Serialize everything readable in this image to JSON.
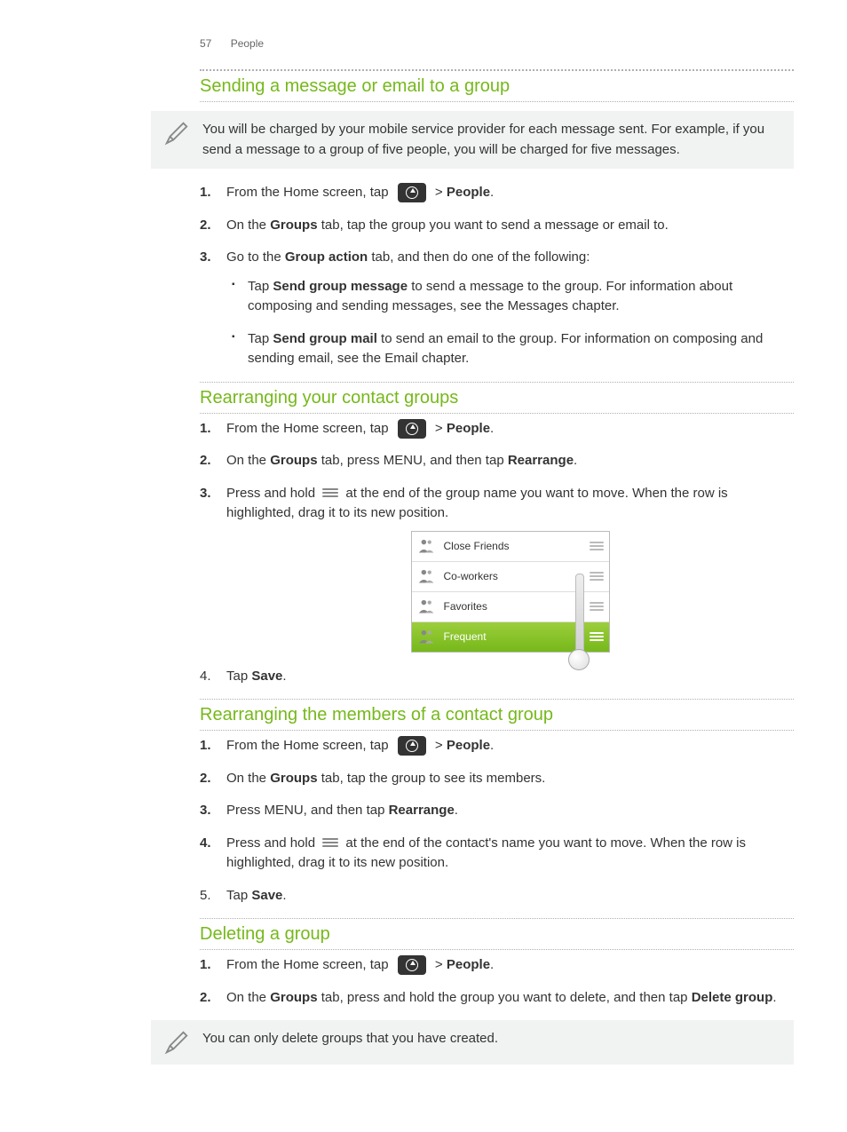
{
  "header": {
    "page_num": "57",
    "chapter": "People"
  },
  "sec1": {
    "title": "Sending a message or email to a group",
    "note": "You will be charged by your mobile service provider for each message sent. For example, if you send a message to a group of five people, you will be charged for five messages.",
    "s1a": "From the Home screen, tap",
    "s1b": "> ",
    "s1c": "People",
    "s1d": ".",
    "s2a": "On the ",
    "s2b": "Groups",
    "s2c": " tab, tap the group you want to send a message or email to.",
    "s3a": "Go to the ",
    "s3b": "Group action",
    "s3c": " tab, and then do one of the following:",
    "b1a": "Tap ",
    "b1b": "Send group message",
    "b1c": " to send a message to the group. For information about composing and sending messages, see the Messages chapter.",
    "b2a": "Tap ",
    "b2b": "Send group mail",
    "b2c": " to send an email to the group. For information on composing and sending email, see the Email chapter."
  },
  "sec2": {
    "title": "Rearranging your contact groups",
    "s1a": "From the Home screen, tap",
    "s1b": "> ",
    "s1c": "People",
    "s1d": ".",
    "s2a": "On the ",
    "s2b": "Groups",
    "s2c": " tab, press MENU, and then tap ",
    "s2d": "Rearrange",
    "s2e": ".",
    "s3a": "Press and hold ",
    "s3b": " at the end of the group name you want to move. When the row is highlighted, drag it to its new position.",
    "s4a": "Tap ",
    "s4b": "Save",
    "s4c": ".",
    "groups": {
      "r1": "Close Friends",
      "r2": "Co-workers",
      "r3": "Favorites",
      "r4": "Frequent"
    }
  },
  "sec3": {
    "title": "Rearranging the members of a contact group",
    "s1a": "From the Home screen, tap",
    "s1b": "> ",
    "s1c": "People",
    "s1d": ".",
    "s2a": "On the ",
    "s2b": "Groups",
    "s2c": " tab, tap the group to see its members.",
    "s3a": "Press MENU, and then tap ",
    "s3b": "Rearrange",
    "s3c": ".",
    "s4a": "Press and hold ",
    "s4b": " at the end of the contact's name you want to move. When the row is highlighted, drag it to its new position.",
    "s5a": "Tap ",
    "s5b": "Save",
    "s5c": "."
  },
  "sec4": {
    "title": "Deleting a group",
    "s1a": "From the Home screen, tap",
    "s1b": "> ",
    "s1c": "People",
    "s1d": ".",
    "s2a": "On the ",
    "s2b": "Groups",
    "s2c": " tab, press and hold the group you want to delete, and then tap ",
    "s2d": "Delete group",
    "s2e": ".",
    "note": "You can only delete groups that you have created."
  }
}
